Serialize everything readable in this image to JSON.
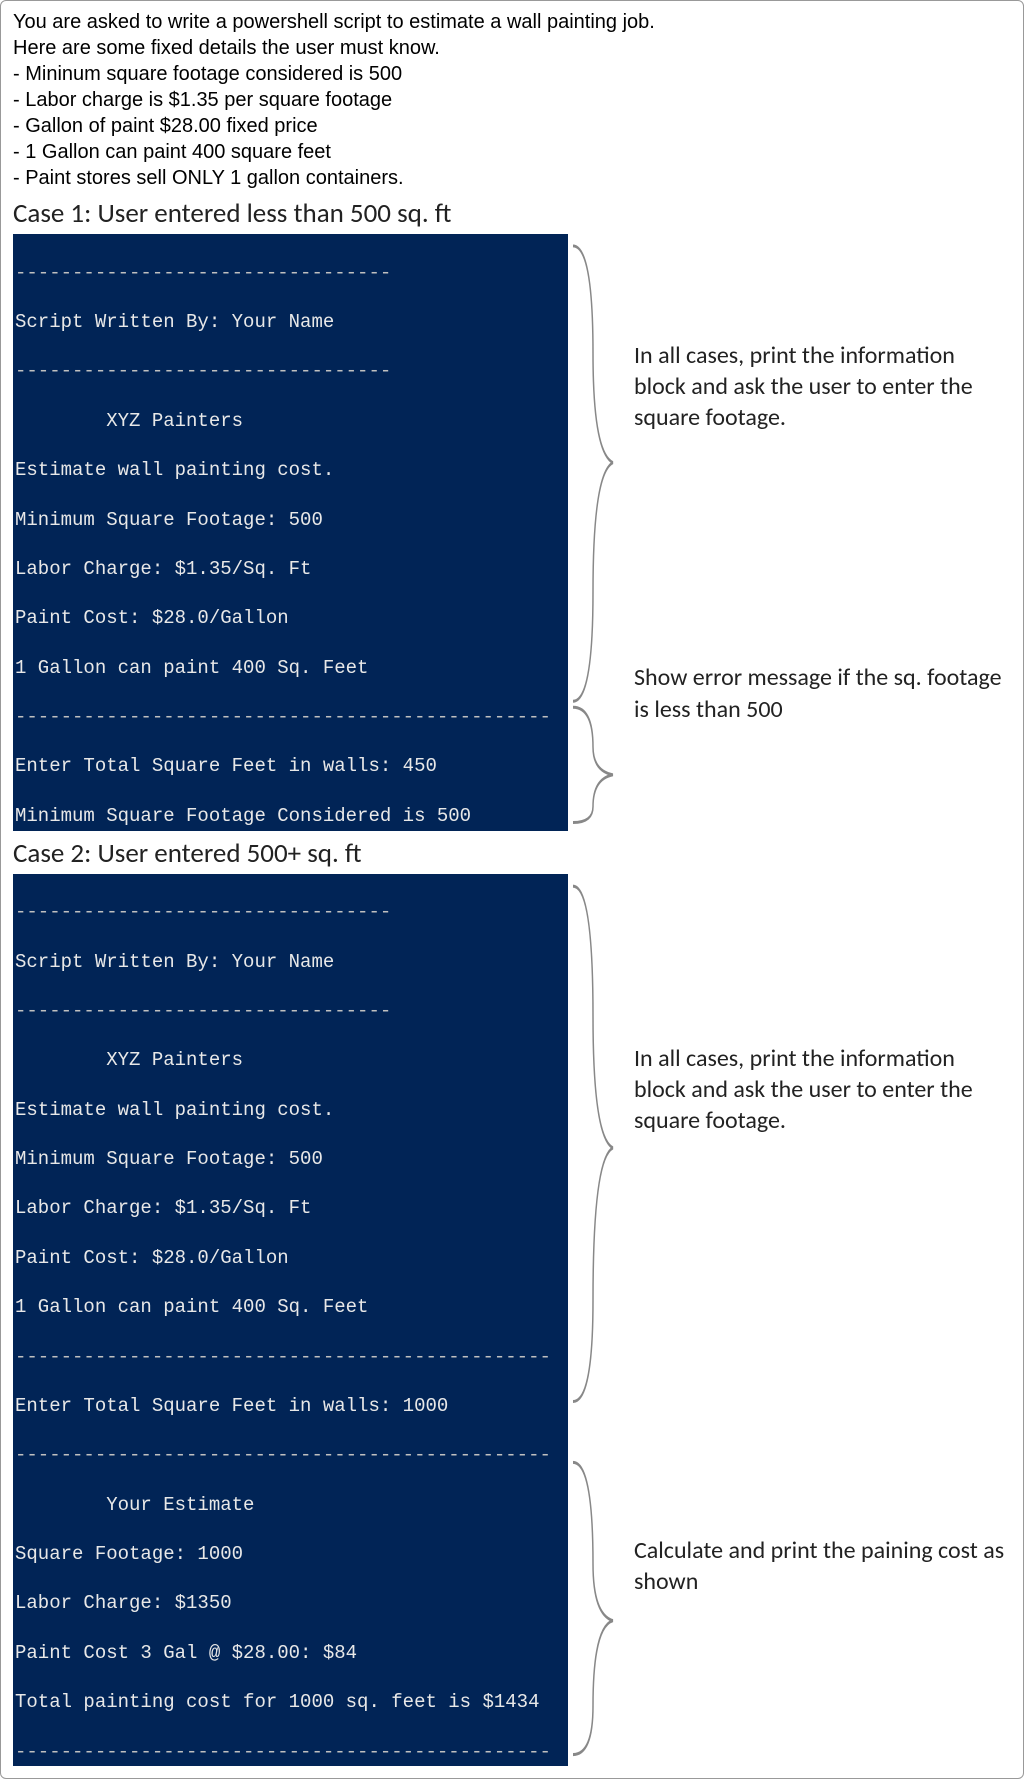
{
  "intro": {
    "l1": "You are asked to write a powershell script to estimate a wall painting job.",
    "l2": "Here are some fixed details the user must know.",
    "b1": "- Mininum square footage considered is 500",
    "b2": "- Labor charge is $1.35 per square footage",
    "b3": "- Gallon of paint $28.00 fixed price",
    "b4": "- 1 Gallon can paint 400 square feet",
    "b5": "- Paint stores sell ONLY 1 gallon containers."
  },
  "case1": {
    "heading": "Case 1: User entered less than 500 sq. ft",
    "term": {
      "l0": "---------------------------------",
      "l1": "Script Written By: Your Name",
      "l2": "---------------------------------",
      "l3": "        XYZ Painters",
      "l4": "Estimate wall painting cost.",
      "l5": "Minimum Square Footage: 500",
      "l6": "Labor Charge: $1.35/Sq. Ft",
      "l7": "Paint Cost: $28.0/Gallon",
      "l8": "1 Gallon can paint 400 Sq. Feet",
      "l9": "-----------------------------------------------",
      "l10": "Enter Total Square Feet in walls: 450",
      "l11": "Minimum Square Footage Considered is 500"
    },
    "annot1": "In all cases, print the information block and ask the user to enter the square footage.",
    "annot2": "Show error message if the sq. footage is less than 500"
  },
  "case2": {
    "heading": "Case 2: User entered 500+ sq. ft",
    "term": {
      "l0": "---------------------------------",
      "l1": "Script Written By: Your Name",
      "l2": "---------------------------------",
      "l3": "        XYZ Painters",
      "l4": "Estimate wall painting cost.",
      "l5": "Minimum Square Footage: 500",
      "l6": "Labor Charge: $1.35/Sq. Ft",
      "l7": "Paint Cost: $28.0/Gallon",
      "l8": "1 Gallon can paint 400 Sq. Feet",
      "l9": "-----------------------------------------------",
      "l10": "Enter Total Square Feet in walls: 1000",
      "l11": "-----------------------------------------------",
      "l12": "        Your Estimate",
      "l13": "Square Footage: 1000",
      "l14": "Labor Charge: $1350",
      "l15": "Paint Cost 3 Gal @ $28.00: $84",
      "l16": "Total painting cost for 1000 sq. feet is $1434",
      "l17": "-----------------------------------------------"
    },
    "annot1": "In all cases, print the information block and ask the user to enter the square footage.",
    "annot2": "Calculate and print the paining cost as shown"
  }
}
